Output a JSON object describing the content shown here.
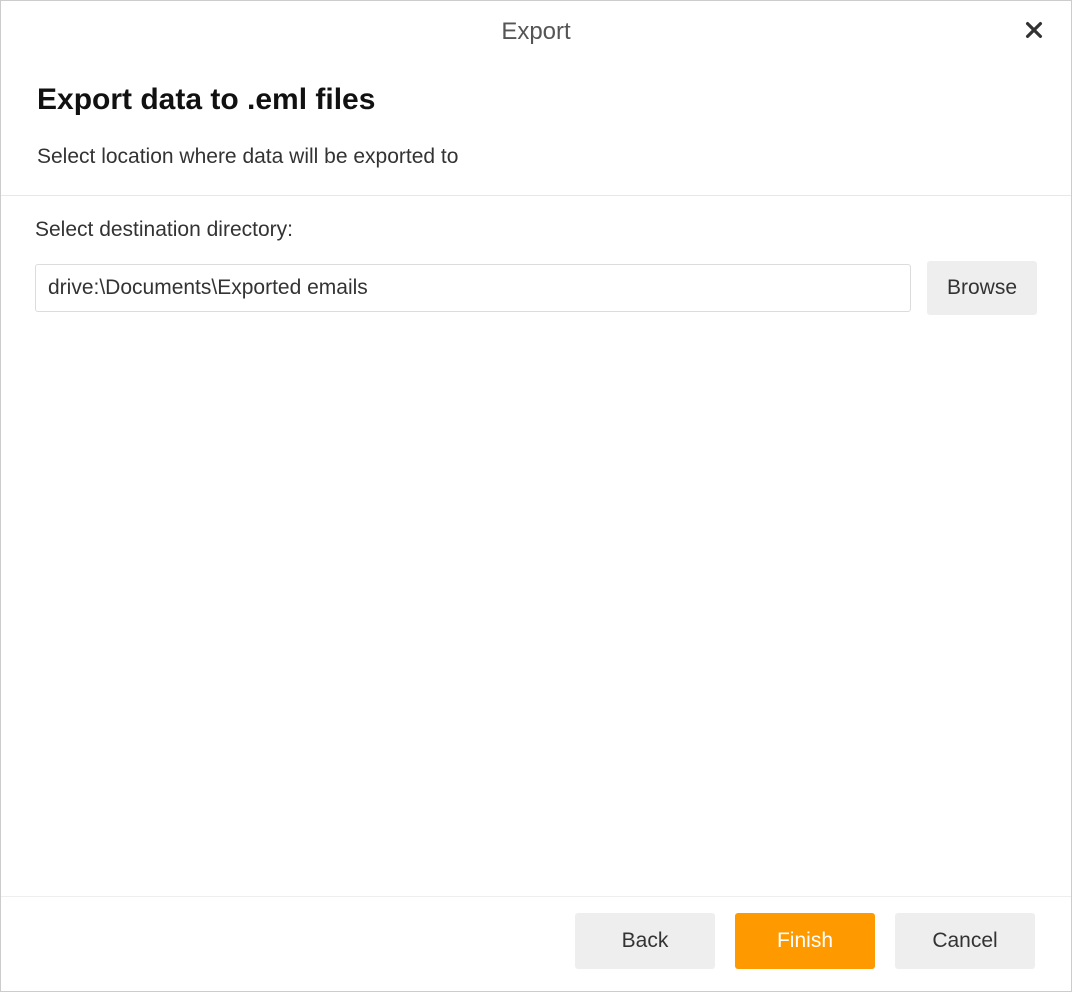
{
  "dialog": {
    "title": "Export",
    "header": {
      "title": "Export data to .eml files",
      "subtitle": "Select location where data will be exported to"
    },
    "content": {
      "label": "Select destination directory:",
      "path_value": "drive:\\Documents\\Exported emails",
      "browse_label": "Browse"
    },
    "footer": {
      "back_label": "Back",
      "finish_label": "Finish",
      "cancel_label": "Cancel"
    }
  }
}
